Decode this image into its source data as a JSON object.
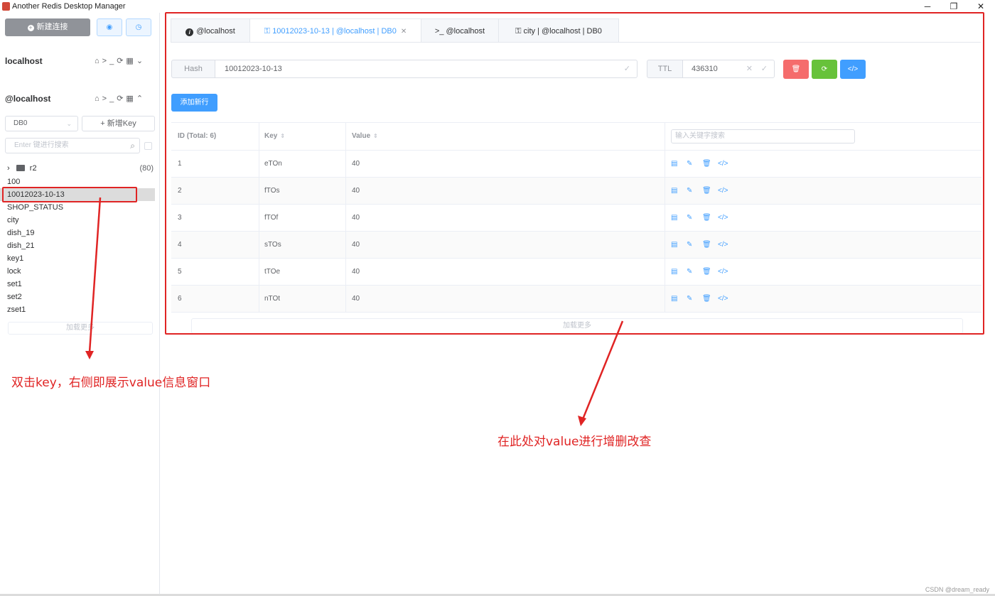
{
  "window": {
    "title": "Another Redis Desktop Manager",
    "controls": [
      "─",
      "❐",
      "✕"
    ]
  },
  "sidebar": {
    "new_connection_label": "新建连接",
    "connections": [
      {
        "name": "localhost"
      },
      {
        "name": "@localhost"
      }
    ],
    "db_select": "DB0",
    "new_key_label": "+ 新增Key",
    "search_placeholder": "Enter 键进行搜索",
    "folder": {
      "name": "r2",
      "count": "(80)"
    },
    "keys": [
      "100",
      "10012023-10-13",
      "SHOP_STATUS",
      "city",
      "dish_19",
      "dish_21",
      "key1",
      "lock",
      "set1",
      "set2",
      "zset1"
    ],
    "selected_key": "10012023-10-13",
    "load_more": "加载更多"
  },
  "tabs": [
    {
      "icon": "info-icon",
      "label": "@localhost"
    },
    {
      "icon": "key-icon",
      "label": "10012023-10-13 | @localhost | DB0",
      "active": true
    },
    {
      "icon": "terminal-icon",
      "label": "@localhost"
    },
    {
      "icon": "key-icon",
      "label": "city | @localhost | DB0"
    }
  ],
  "key_detail": {
    "type": "Hash",
    "key_name": "10012023-10-13",
    "ttl_label": "TTL",
    "ttl": "436310",
    "add_row_label": "添加新行",
    "colors": {
      "delete": "#f56c6c",
      "refresh": "#67c23a",
      "code": "#409eff"
    }
  },
  "table": {
    "headers": {
      "id": "ID (Total: 6)",
      "key": "Key",
      "value": "Value"
    },
    "search_placeholder": "输入关键字搜索",
    "rows": [
      {
        "id": "1",
        "key": "eTOn",
        "value": "40"
      },
      {
        "id": "2",
        "key": "fTOs",
        "value": "40"
      },
      {
        "id": "3",
        "key": "fTOf",
        "value": "40"
      },
      {
        "id": "4",
        "key": "sTOs",
        "value": "40"
      },
      {
        "id": "5",
        "key": "tTOe",
        "value": "40"
      },
      {
        "id": "6",
        "key": "nTOt",
        "value": "40"
      }
    ],
    "load_more": "加载更多"
  },
  "annotations": {
    "left_note": "双击key，右侧即展示value信息窗口",
    "right_note": "在此处对value进行增删改查",
    "color": "#e02424"
  },
  "watermark": "CSDN @dream_ready"
}
